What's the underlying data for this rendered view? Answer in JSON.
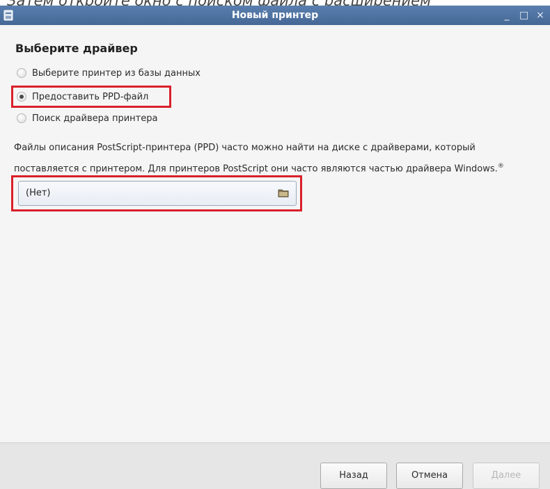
{
  "caption": "Затем откройте окно с поиском файла с расширением",
  "window": {
    "title": "Новый принтер",
    "controls": {
      "minimize": "_",
      "maximize": "□",
      "close": "×"
    }
  },
  "heading": "Выберите драйвер",
  "options": [
    {
      "label": "Выберите принтер из базы данных",
      "checked": false
    },
    {
      "label": "Предоставить PPD-файл",
      "checked": true
    },
    {
      "label": "Поиск драйвера принтера",
      "checked": false
    }
  ],
  "description": {
    "line1": "Файлы описания PostScript-принтера (PPD) часто можно найти на диске с драйверами, который",
    "line2": "поставляется с принтером. Для принтеров PostScript они часто являются частью драйвера Windows.",
    "reg": "®"
  },
  "file_chooser": {
    "value": "(Нет)",
    "icon": "folder-icon"
  },
  "buttons": {
    "back": "Назад",
    "cancel": "Отмена",
    "next": "Далее"
  },
  "colors": {
    "titlebar": "#4b6f9d",
    "highlight": "#d9202a"
  }
}
